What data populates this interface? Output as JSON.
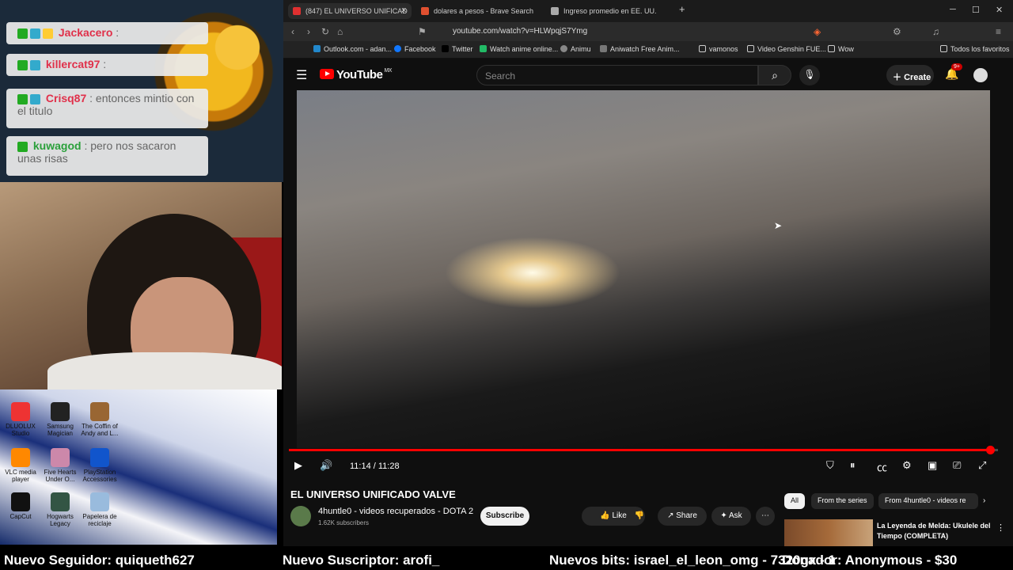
{
  "chat": {
    "messages": [
      {
        "user": "Jackacero",
        "text": ":",
        "color": "#e0304a"
      },
      {
        "user": "killercat97",
        "text": ":",
        "color": "#e0304a"
      },
      {
        "user": "Crisq87",
        "text": ": entonces mintio con el titulo",
        "color": "#e0304a"
      },
      {
        "user": "kuwagod",
        "text": ": pero nos sacaron unas risas",
        "color": "#2aa03a"
      }
    ]
  },
  "desktop": {
    "icons": [
      "DLUOLUX Studio",
      "Samsung Magician",
      "The Coffin of Andy and L...",
      "VLC media player",
      "Five Hearts Under O...",
      "PlayStation Accessories",
      "CapCut",
      "Hogwarts Legacy",
      "Papelera de reciclaje"
    ]
  },
  "ticker": {
    "follower": "Nuevo Seguidor: quiqueth627",
    "subscriber": "Nuevo Suscriptor: arofi_",
    "bits": "Nuevos bits: israel_el_leon_omg - 7320gx - 1",
    "donor": "Donador: Anonymous - $30"
  },
  "browser": {
    "tabs": [
      {
        "label": "(847) EL UNIVERSO UNIFICAD",
        "color": "#e03030"
      },
      {
        "label": "dolares a pesos - Brave Search",
        "color": "#e05030"
      },
      {
        "label": "Ingreso promedio en EE. UU.",
        "color": "#aaaaaa"
      }
    ],
    "new_tab": "+",
    "url": "youtube.com/watch?v=HLWpqjS7Ymg",
    "bookmarks": [
      "Outlook.com - adan...",
      "Facebook",
      "Twitter",
      "Watch anime online...",
      "Animu",
      "Aniwatch Free Anim...",
      "vamonos",
      "Video Genshin FUE...",
      "Wow"
    ],
    "all_bookmarks": "Todos los favoritos"
  },
  "youtube": {
    "logo": "YouTube",
    "region": "MX",
    "search_placeholder": "Search",
    "create_label": "Create",
    "notif_badge": "9+",
    "time_display": "11:14 / 11:28",
    "progress": 0.989,
    "video_title": "EL UNIVERSO UNIFICADO VALVE",
    "channel_name": "4huntle0 - videos recuperados - DOTA 2",
    "subscribers": "1.62K subscribers",
    "subscribe_label": "Subscribe",
    "like_label": "Like",
    "share_label": "Share",
    "ask_label": "Ask",
    "chips": [
      "All",
      "From the series",
      "From 4huntle0 - videos re"
    ],
    "rec_title": "La Leyenda de Melda: Ukulele del Tiempo (COMPLETA)"
  }
}
